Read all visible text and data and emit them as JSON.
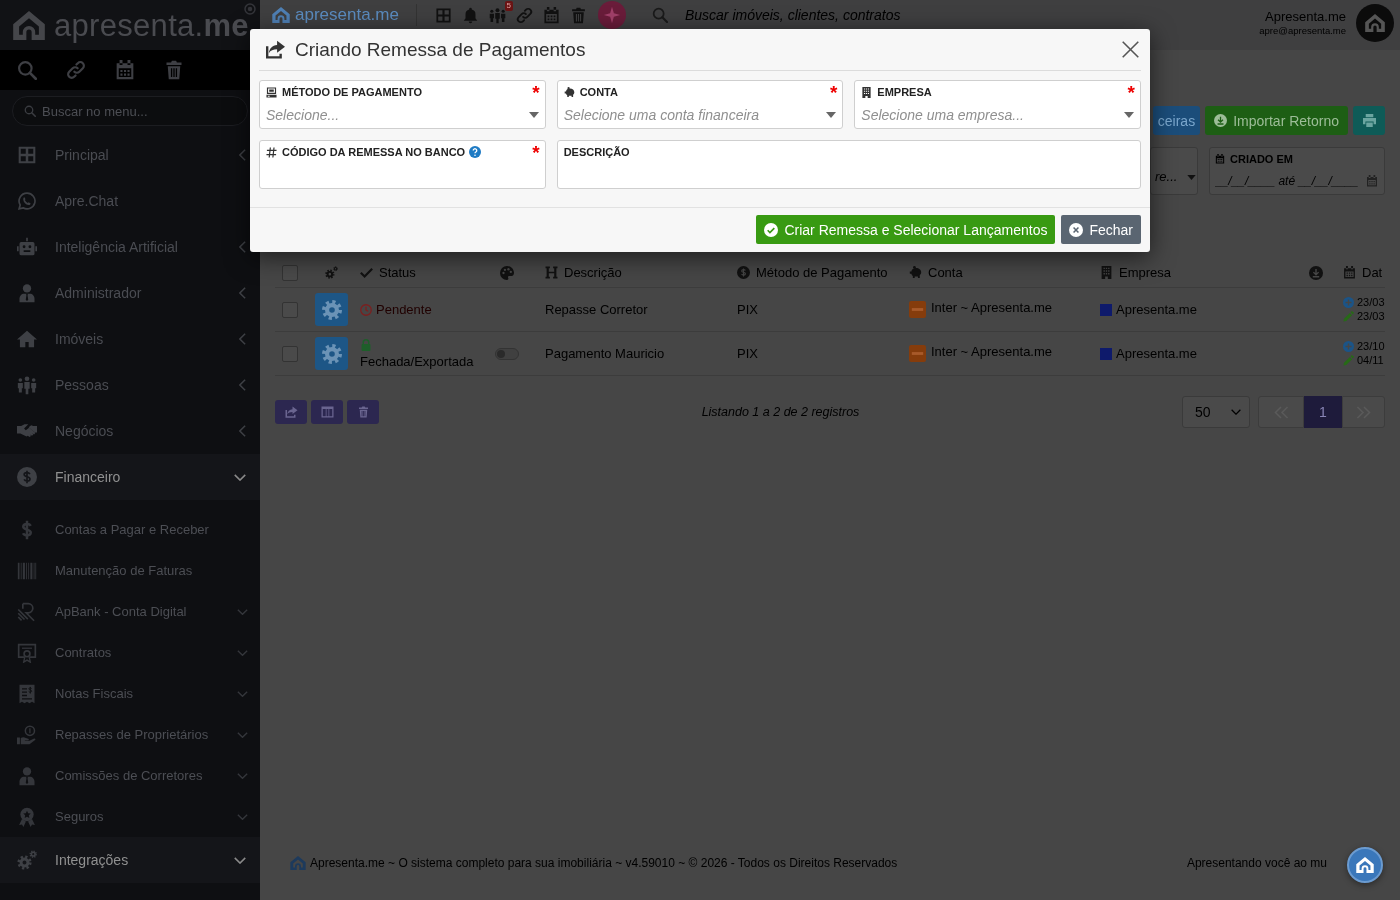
{
  "sidebar": {
    "logo": "apresenta.**me**",
    "search": {
      "placeholder": "Buscar no menu..."
    },
    "items": [
      {
        "label": "Principal",
        "expanded": false,
        "highlighted": false
      },
      {
        "label": "Apre.Chat",
        "highlighted": false
      },
      {
        "label": "Inteligência Artificial",
        "expanded": false,
        "highlighted": false
      },
      {
        "label": "Administrador",
        "expanded": false,
        "highlighted": false
      },
      {
        "label": "Imóveis",
        "expanded": false,
        "highlighted": false
      },
      {
        "label": "Pessoas",
        "expanded": false,
        "highlighted": false
      },
      {
        "label": "Negócios",
        "expanded": false,
        "highlighted": false
      },
      {
        "label": "Financeiro",
        "expanded": true,
        "highlighted": true,
        "children": [
          {
            "label": "Contas a Pagar e Receber"
          },
          {
            "label": "Manutenção de Faturas"
          },
          {
            "label": "ApBank - Conta Digital",
            "has_submenu": true
          },
          {
            "label": "Contratos",
            "has_submenu": true
          },
          {
            "label": "Notas Fiscais",
            "has_submenu": true
          },
          {
            "label": "Repasses de Proprietários",
            "has_submenu": true
          },
          {
            "label": "Comissões de Corretores",
            "has_submenu": true
          },
          {
            "label": "Seguros",
            "has_submenu": true
          }
        ]
      },
      {
        "label": "Integrações",
        "expanded": true,
        "highlighted": true
      }
    ]
  },
  "topbar": {
    "logo": "apresenta.me",
    "notification_count": "5",
    "search": {
      "placeholder": "Buscar imóveis, clientes, contratos"
    },
    "user": {
      "name": "Apresenta.me",
      "email": "apre@apresenta.me"
    }
  },
  "toolbar": {
    "buttons": [
      {
        "label": "ceiras",
        "kind": "info"
      },
      {
        "label": "Importar Retorno",
        "kind": "success"
      },
      {
        "kind": "print"
      }
    ]
  },
  "filters": [
    {
      "kind": "select",
      "placeholder": "re..."
    },
    {
      "kind": "date_range",
      "label": "CRIADO EM",
      "placeholder": "__/__/____ até __/__/____"
    }
  ],
  "table": {
    "select_all": false,
    "columns": [
      "Status",
      "Descrição",
      "Método de Pagamento",
      "Conta",
      "Empresa",
      "Dat"
    ],
    "rows": [
      {
        "selected": false,
        "status": {
          "label": "Pendente",
          "kind": "pending"
        },
        "description": "Repasse Corretor",
        "method": "PIX",
        "account": "Inter ~ Apresenta.me",
        "company": "Apresenta.me",
        "created": "23/03",
        "edited": "23/03"
      },
      {
        "selected": false,
        "status": {
          "label": "Fechada/Exportada",
          "kind": "closed"
        },
        "toggle_on": false,
        "description": "Pagamento Mauricio",
        "method": "PIX",
        "account": "Inter ~ Apresenta.me",
        "company": "Apresenta.me",
        "created": "23/10",
        "edited": "04/11"
      }
    ]
  },
  "pager": {
    "summary": "Listando 1 a 2 de 2 registros",
    "per_page": "50",
    "pages": [
      {
        "label": "1",
        "selected": true
      }
    ]
  },
  "modal": {
    "title": "Criando Remessa de Pagamentos",
    "fields": [
      {
        "label": "MÉTODO DE PAGAMENTO",
        "kind": "select",
        "required_mark": "*",
        "placeholder": "Selecione..."
      },
      {
        "label": "CONTA",
        "kind": "select",
        "required_mark": "*",
        "placeholder": "Selecione uma conta financeira"
      },
      {
        "label": "EMPRESA",
        "kind": "select",
        "required_mark": "*",
        "placeholder": "Selecione uma empresa..."
      },
      {
        "label": "CÓDIGO DA REMESSA NO BANCO",
        "kind": "text",
        "required_mark": "*",
        "help": true
      },
      {
        "label": "DESCRIÇÃO",
        "kind": "text"
      }
    ],
    "buttons": [
      {
        "label": "Criar Remessa e Selecionar Lançamentos",
        "kind": "primary"
      },
      {
        "label": "Fechar",
        "kind": "secondary"
      }
    ]
  },
  "footer": {
    "text": "Apresenta.me ~ O sistema completo para sua imobiliária ~ v4.59010 ~ © 2026 - Todos os Direitos Reservados",
    "right_text": "Apresentando você ao mu"
  }
}
